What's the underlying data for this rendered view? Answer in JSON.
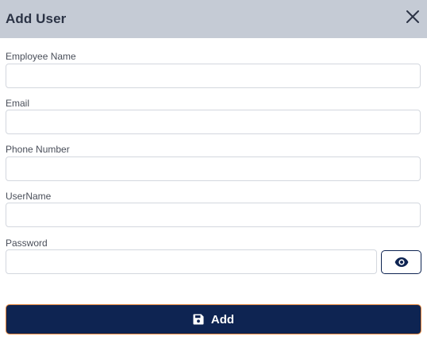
{
  "dialog": {
    "title": "Add User",
    "close_icon": "close-icon"
  },
  "fields": {
    "employee_name": {
      "label": "Employee Name",
      "value": "",
      "placeholder": ""
    },
    "email": {
      "label": "Email",
      "value": "",
      "placeholder": ""
    },
    "phone_number": {
      "label": "Phone Number",
      "value": "",
      "placeholder": ""
    },
    "username": {
      "label": "UserName",
      "value": "",
      "placeholder": ""
    },
    "password": {
      "label": "Password",
      "value": "",
      "placeholder": "",
      "toggle_icon": "eye-icon"
    }
  },
  "actions": {
    "add_label": "Add",
    "add_icon": "save-icon"
  },
  "colors": {
    "header_bg": "#c5cbd5",
    "primary": "#0e2452",
    "accent_border": "#e2843a"
  }
}
